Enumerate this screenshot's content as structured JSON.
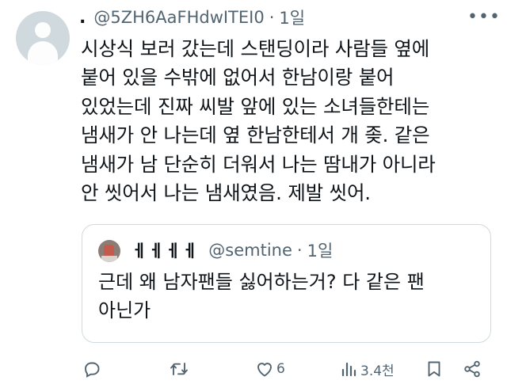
{
  "tweet": {
    "handle": "@5ZH6AaFHdwITEI0",
    "time": "1일",
    "text": "시상식 보러 갔는데 스탠딩이라 사람들 옆에\n붙어 있을 수밖에 없어서 한남이랑 붙어\n있었는데 진짜 씨발 앞에 있는 소녀들한테는\n냄새가 안 나는데 옆 한남한테서 개 좆. 같은\n냄새가 남 단순히 더워서 나는 땀내가 아니라\n안 씻어서 나는 냄새였음. 제발 씻어."
  },
  "quote": {
    "name": "ㅔㅔㅔㅔ",
    "handle": "@semtine",
    "time": "1일",
    "text": "근데 왜 남자팬들 싫어하는거? 다 같은 팬\n아닌가"
  },
  "actions": {
    "likes": "6",
    "views": "3.4천"
  },
  "icons": [
    "avatar",
    "more-icon",
    "reply-icon",
    "retweet-icon",
    "like-icon",
    "views-icon",
    "bookmark-icon",
    "share-icon"
  ],
  "colors": {
    "text": "#0f1419",
    "muted": "#536471",
    "border": "#cfd9de"
  }
}
